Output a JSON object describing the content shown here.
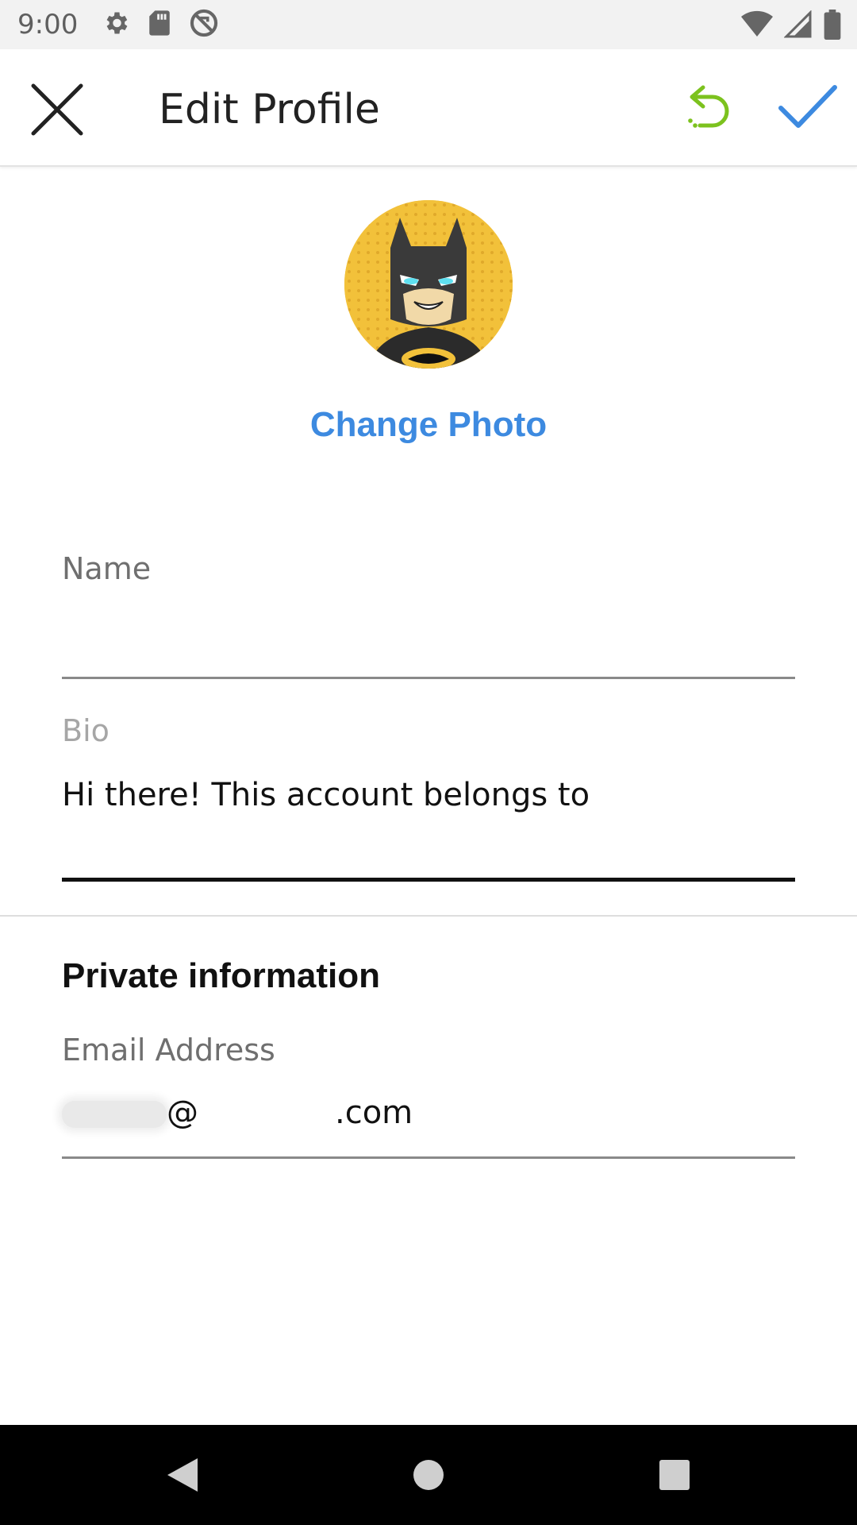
{
  "status_bar": {
    "time": "9:00",
    "icons_left": [
      "settings-icon",
      "sd-card-icon",
      "sync-off-icon"
    ],
    "icons_right": [
      "wifi-icon",
      "cell-signal-icon",
      "battery-icon"
    ]
  },
  "app_bar": {
    "title": "Edit Profile",
    "close_icon": "close-icon",
    "undo_icon": "undo-icon",
    "confirm_icon": "check-icon"
  },
  "profile": {
    "change_photo_label": "Change Photo"
  },
  "form": {
    "name_label": "Name",
    "name_value": "",
    "bio_label": "Bio",
    "bio_value": "Hi there! This account belongs to",
    "private_section_title": "Private information",
    "email_label": "Email Address",
    "email_at": "@",
    "email_suffix": ".com"
  },
  "colors": {
    "accent_blue": "#3d8ae0",
    "undo_green": "#7cc21e",
    "status_bar_bg": "#f2f2f2",
    "nav_bar_bg": "#000000"
  },
  "nav_bar": {
    "back_icon": "back-triangle-icon",
    "home_icon": "home-circle-icon",
    "recents_icon": "recents-square-icon"
  }
}
